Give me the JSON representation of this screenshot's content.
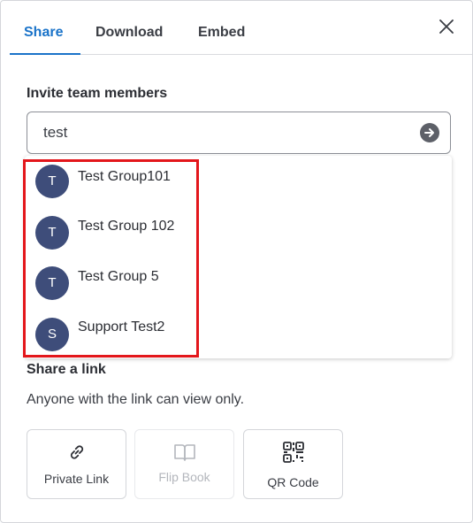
{
  "tabs": [
    {
      "label": "Share",
      "active": true
    },
    {
      "label": "Download",
      "active": false
    },
    {
      "label": "Embed",
      "active": false
    }
  ],
  "invite": {
    "title": "Invite team members",
    "search_value": "test"
  },
  "results": [
    {
      "initial": "T",
      "label": "Test Group101"
    },
    {
      "initial": "T",
      "label": "Test Group 102"
    },
    {
      "initial": "T",
      "label": "Test Group 5"
    },
    {
      "initial": "S",
      "label": "Support Test2"
    }
  ],
  "share_link": {
    "title": "Share a link",
    "description": "Anyone with the link can view only.",
    "options": [
      {
        "label": "Private Link",
        "icon": "link-icon",
        "enabled": true
      },
      {
        "label": "Flip Book",
        "icon": "book-icon",
        "enabled": false
      },
      {
        "label": "QR Code",
        "icon": "qr-code-icon",
        "enabled": true
      }
    ]
  },
  "colors": {
    "accent": "#1a73c9",
    "avatar": "#3e4d7a",
    "highlight": "#e3161b"
  }
}
